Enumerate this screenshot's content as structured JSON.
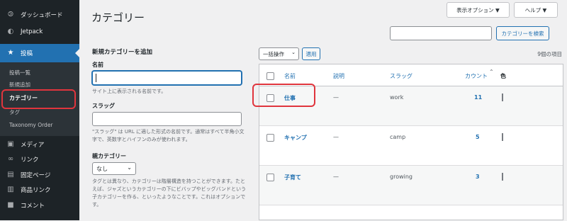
{
  "sidebar": {
    "dashboard": {
      "icon": "⧁",
      "label": "ダッシュボード"
    },
    "jetpack": {
      "icon": "◐",
      "label": "Jetpack"
    },
    "posts": {
      "icon": "★",
      "label": "投稿"
    },
    "submenu": [
      "投稿一覧",
      "新規追加",
      "カテゴリー",
      "タグ",
      "Taxonomy Order"
    ],
    "media": {
      "icon": "▣",
      "label": "メディア"
    },
    "links": {
      "icon": "∞",
      "label": "リンク"
    },
    "pages": {
      "icon": "▤",
      "label": "固定ページ"
    },
    "product_links": {
      "icon": "▥",
      "label": "商品リンク"
    },
    "comments": {
      "icon": "■",
      "label": "コメント"
    }
  },
  "header": {
    "title": "カテゴリー",
    "screen_options": "表示オプション ▼",
    "help": "ヘルプ ▼",
    "search_placeholder": "",
    "search_button": "カテゴリーを検索"
  },
  "form": {
    "heading": "新規カテゴリーを追加",
    "name_label": "名前",
    "name_value": "",
    "name_help": "サイト上に表示される名前です。",
    "slug_label": "スラッグ",
    "slug_value": "",
    "slug_help": "\"スラッグ\" は URL に適した形式の名前です。通常はすべて半角小文字で、英数字とハイフンのみが使われます。",
    "parent_label": "親カテゴリー",
    "parent_value": "なし",
    "parent_help": "タグとは異なり、カテゴリーは階層構造を持つことができます。たとえば、ジャズというカテゴリーの下にビバップやビッグバンドという子カテゴリーを作る、といったようなことです。これはオプションです。"
  },
  "table": {
    "bulk_action": "一括操作",
    "apply": "適用",
    "item_count": "9個の項目",
    "headers": {
      "name": "名前",
      "description": "説明",
      "slug": "スラッグ",
      "count": "カウント",
      "color": "色",
      "sort_icon": "⌃"
    },
    "rows": [
      {
        "name": "仕事",
        "description": "—",
        "slug": "work",
        "count": "11"
      },
      {
        "name": "キャンプ",
        "description": "—",
        "slug": "camp",
        "count": "5"
      },
      {
        "name": "子育て",
        "description": "—",
        "slug": "growing",
        "count": "3"
      }
    ]
  },
  "colors": {
    "sidebar_bg": "#1d2327",
    "accent": "#2271b1",
    "highlight": "#e0353d"
  }
}
